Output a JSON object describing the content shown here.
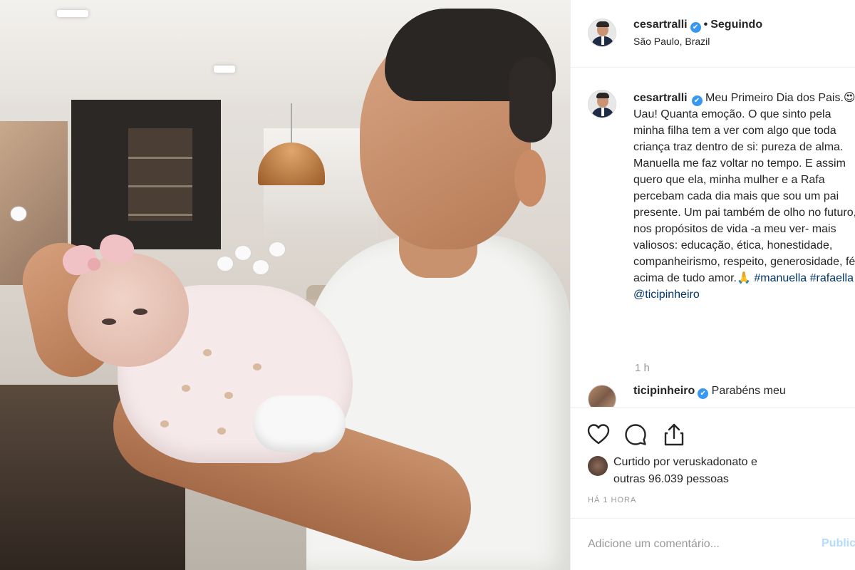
{
  "post": {
    "username": "cesartralli",
    "verified_badge": "✔",
    "separator": "•",
    "follow_status": "Seguindo",
    "location": "São Paulo, Brazil"
  },
  "caption": {
    "username": "cesartralli",
    "text_1": " Meu Primeiro Dia dos Pais.",
    "emoji_1": "😍",
    "text_2": "Uau! Quanta emoção. O que sinto pela minha filha tem a ver com algo que toda criança traz dentro de si: pureza de alma. Manuella me faz voltar no tempo. E assim quero que ela, minha mulher e a Rafa percebam cada dia mais que sou um pai presente. Um pai também de olho no futuro, nos propósitos de vida -a meu ver- mais valiosos: educação, ética, honestidade, companheirismo, respeito, generosidade, fé e acima de tudo amor.",
    "emoji_2": "🙏",
    "hashtag_1": "#manuella",
    "hashtag_2": "#rafaella",
    "mention": "@ticipinheiro",
    "time": "1 h"
  },
  "reply": {
    "username": "ticipinheiro",
    "text": " Parabéns meu"
  },
  "actions": {
    "like_icon": "heart-icon",
    "comment_icon": "comment-icon",
    "share_icon": "share-icon"
  },
  "likes": {
    "line_1": "Curtido por veruskadonato e",
    "line_2": "outras 96.039 pessoas"
  },
  "timestamp": "HÁ 1 HORA",
  "comment_box": {
    "placeholder": "Adicione um comentário...",
    "publish_label": "Publicar"
  },
  "colors": {
    "verified": "#3897f0",
    "link": "#003569",
    "muted": "#999999",
    "publish_disabled": "#b3dbff"
  }
}
